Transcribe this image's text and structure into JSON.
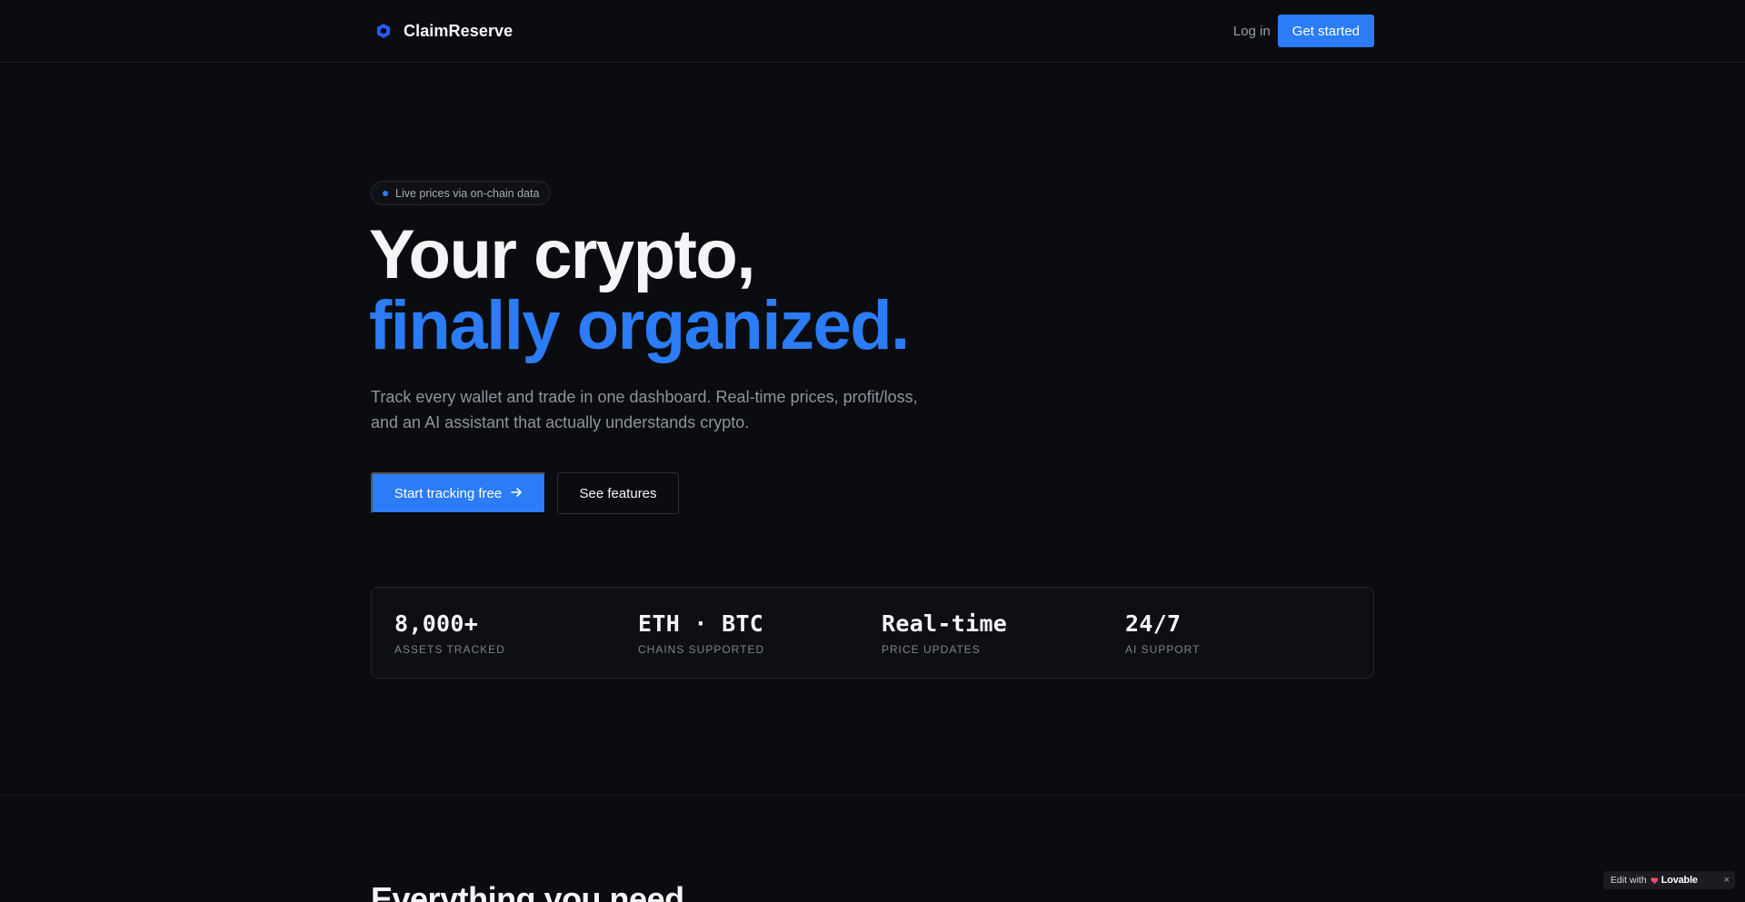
{
  "nav": {
    "brand_name": "ClaimReserve",
    "brand_icon": "hexagon-logo-icon",
    "login_label": "Log in",
    "get_started_label": "Get started"
  },
  "hero": {
    "pill_text": "Live prices via on-chain data",
    "title_line1": "Your crypto,",
    "title_line2": "finally organized.",
    "subtitle": "Track every wallet and trade in one dashboard. Real-time prices, profit/loss, and an AI assistant that actually understands crypto.",
    "cta_primary": "Start tracking free",
    "cta_primary_icon": "arrow-right-icon",
    "cta_secondary": "See features"
  },
  "stats": [
    {
      "value": "8,000+",
      "label": "ASSETS TRACKED"
    },
    {
      "value": "ETH · BTC",
      "label": "CHAINS SUPPORTED"
    },
    {
      "value": "Real-time",
      "label": "PRICE UPDATES"
    },
    {
      "value": "24/7",
      "label": "AI SUPPORT"
    }
  ],
  "features_section": {
    "title": "Everything you need"
  },
  "badge": {
    "prefix": "Edit with",
    "brand": "Lovable",
    "close": "×"
  },
  "colors": {
    "background": "#0b0c0f",
    "accent": "#2b7cf6",
    "text": "#f4f5f7",
    "muted": "#8f939c"
  }
}
